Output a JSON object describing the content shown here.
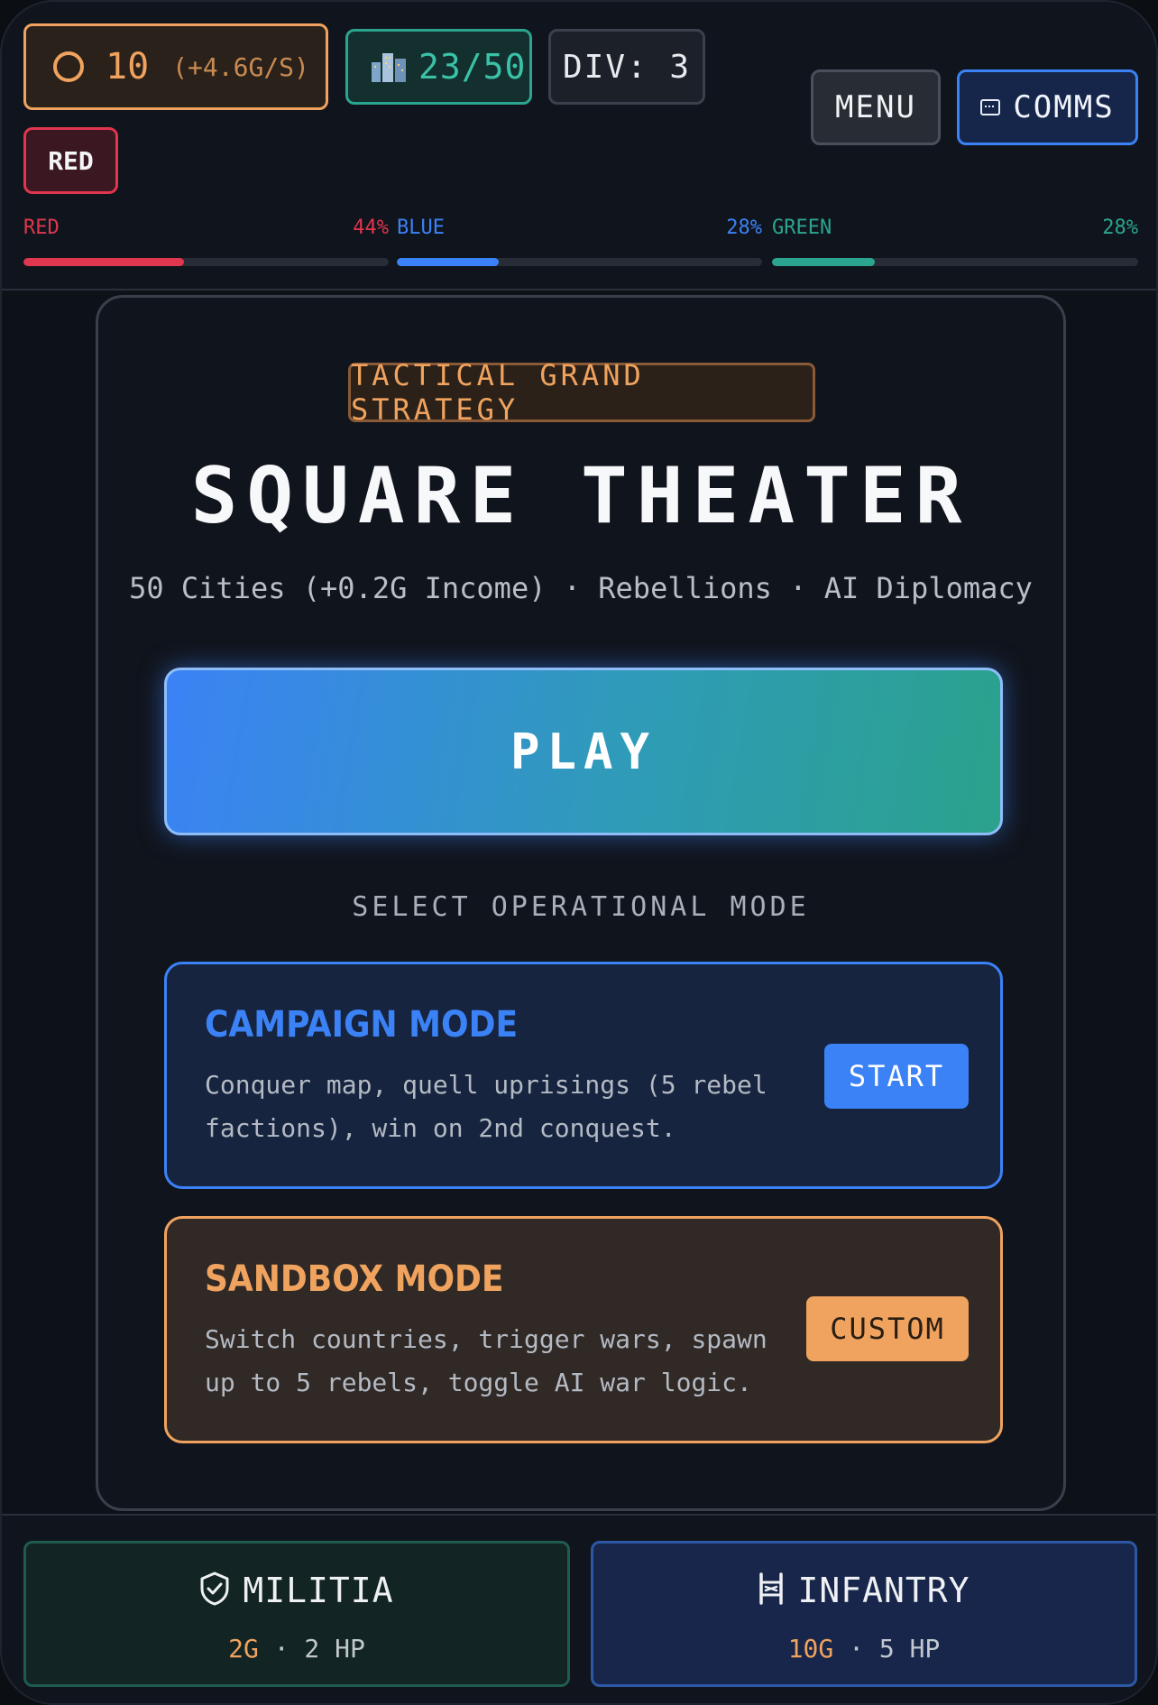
{
  "hud": {
    "gold_amount": "10",
    "gold_rate": "(+4.6G/S)",
    "cities_value": "23/50",
    "div_label": "DIV: 3",
    "menu_label": "MENU",
    "comms_label": "COMMS",
    "team_label": "RED"
  },
  "factions": [
    {
      "name": "RED",
      "percent": "44%",
      "share": 0.44,
      "color": "#e0364e"
    },
    {
      "name": "BLUE",
      "percent": "28%",
      "share": 0.28,
      "color": "#3b82f6"
    },
    {
      "name": "GREEN",
      "percent": "28%",
      "share": 0.28,
      "color": "#2ba58f"
    }
  ],
  "card": {
    "tag": "TACTICAL GRAND STRATEGY",
    "title": "SQUARE THEATER",
    "subtitle": "50 Cities (+0.2G Income) · Rebellions · AI Diplomacy",
    "play_label": "PLAY",
    "select_label": "SELECT OPERATIONAL MODE",
    "campaign": {
      "title": "CAMPAIGN MODE",
      "description": "Conquer map, quell uprisings (5 rebel factions), win on 2nd conquest.",
      "button": "START"
    },
    "sandbox": {
      "title": "SANDBOX MODE",
      "description": "Switch countries, trigger wars, spawn up to 5 rebels, toggle AI war logic.",
      "button": "CUSTOM"
    }
  },
  "units": {
    "militia": {
      "name": "MILITIA",
      "cost": "2G",
      "hp": "2 HP"
    },
    "infantry": {
      "name": "INFANTRY",
      "cost": "10G",
      "hp": "5 HP"
    }
  },
  "colors": {
    "accent_gold": "#f0a35e",
    "accent_blue": "#3b82f6",
    "accent_green": "#2ba58f",
    "accent_red": "#e0364e"
  }
}
